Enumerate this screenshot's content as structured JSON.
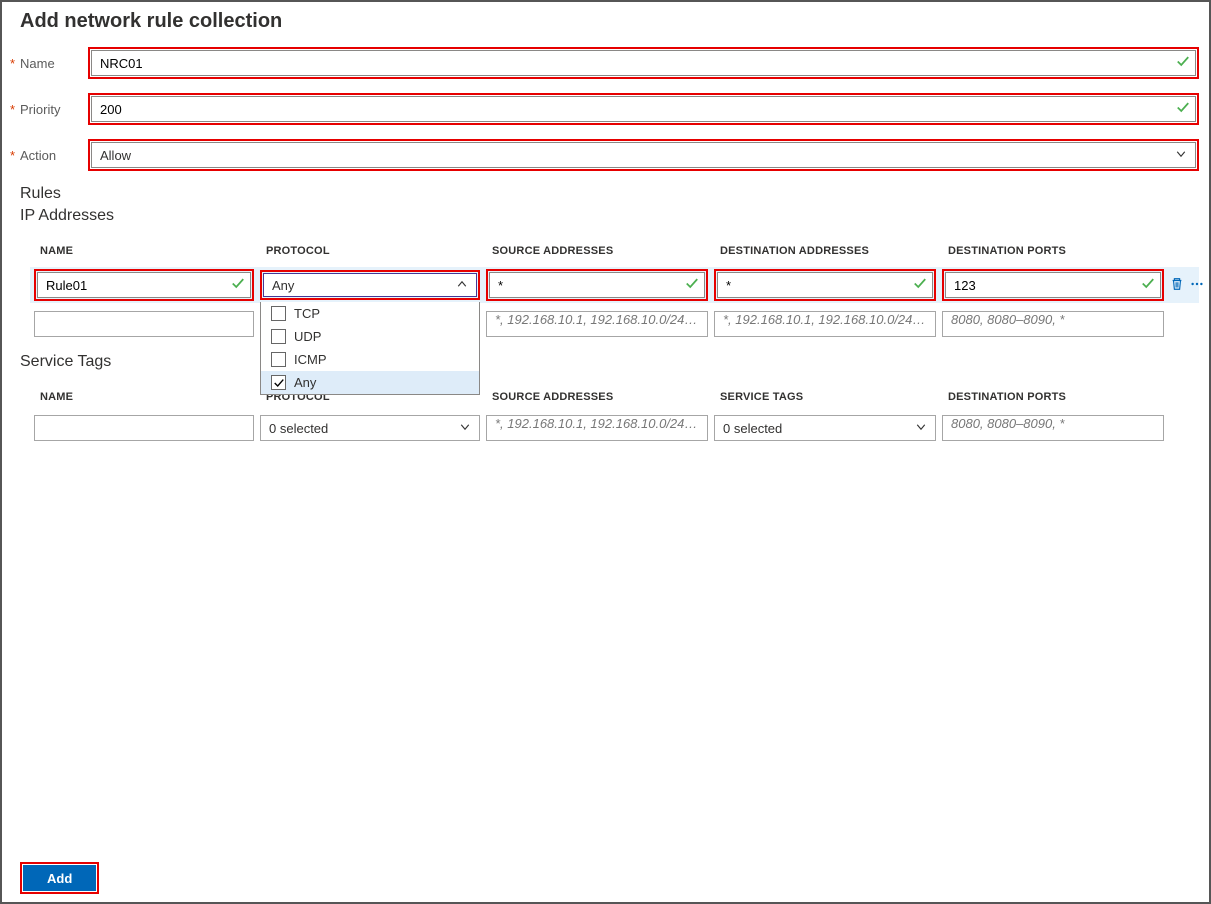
{
  "page_title": "Add network rule collection",
  "form": {
    "name_label": "Name",
    "name_value": "NRC01",
    "priority_label": "Priority",
    "priority_value": "200",
    "action_label": "Action",
    "action_value": "Allow"
  },
  "sections": {
    "rules": "Rules",
    "ip_addresses": "IP Addresses",
    "service_tags": "Service Tags"
  },
  "ip_table": {
    "headers": {
      "name": "NAME",
      "protocol": "PROTOCOL",
      "source_addresses": "SOURCE ADDRESSES",
      "destination_addresses": "DESTINATION ADDRESSES",
      "destination_ports": "DESTINATION PORTS"
    },
    "rows": [
      {
        "name": "Rule01",
        "protocol_selected": "Any",
        "source": "*",
        "destination": "*",
        "dest_ports": "123"
      }
    ],
    "placeholders": {
      "source": "*, 192.168.10.1, 192.168.10.0/24,…",
      "destination": "*, 192.168.10.1, 192.168.10.0/24,…",
      "dest_ports": "8080, 8080–8090, *"
    },
    "protocol_options": [
      {
        "label": "TCP",
        "checked": false
      },
      {
        "label": "UDP",
        "checked": false
      },
      {
        "label": "ICMP",
        "checked": false
      },
      {
        "label": "Any",
        "checked": true
      }
    ]
  },
  "service_tags_table": {
    "headers": {
      "name": "NAME",
      "protocol": "PROTOCOL",
      "source_addresses": "SOURCE ADDRESSES",
      "service_tags": "SERVICE TAGS",
      "destination_ports": "DESTINATION PORTS"
    },
    "row": {
      "protocol_selected": "0 selected",
      "service_tags_selected": "0 selected"
    },
    "placeholders": {
      "source": "*, 192.168.10.1, 192.168.10.0/24,…",
      "dest_ports": "8080, 8080–8090, *"
    }
  },
  "footer": {
    "add_label": "Add"
  }
}
